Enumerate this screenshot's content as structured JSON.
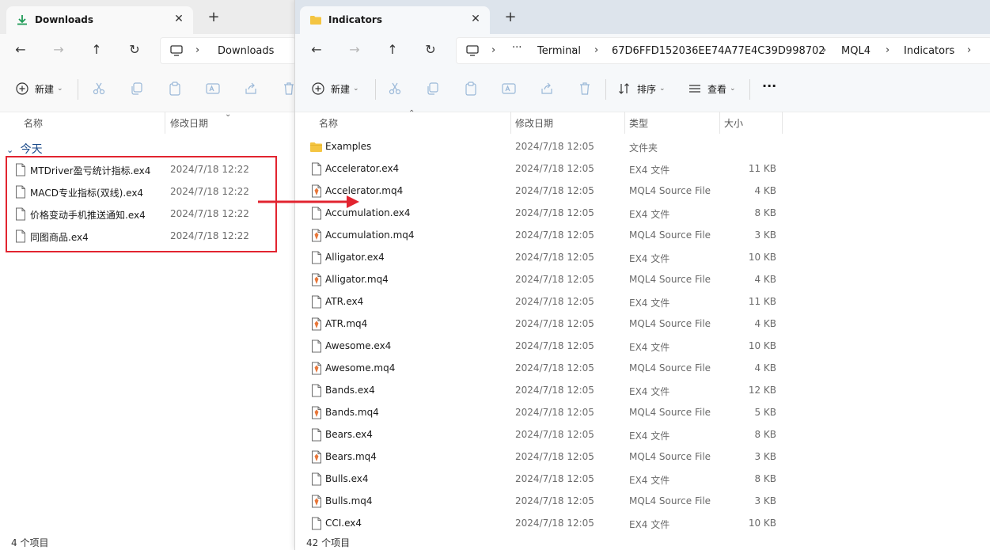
{
  "left": {
    "tab_title": "Downloads",
    "tab_close": "✕",
    "new_tab": "+",
    "breadcrumb": "Downloads",
    "new_label": "新建",
    "columns": {
      "name": "名称",
      "date": "修改日期"
    },
    "group_label": "今天",
    "files": [
      {
        "name": "MTDriver盈亏统计指标.ex4",
        "date": "2024/7/18 12:22"
      },
      {
        "name": "MACD专业指标(双线).ex4",
        "date": "2024/7/18 12:22"
      },
      {
        "name": "价格变动手机推送通知.ex4",
        "date": "2024/7/18 12:22"
      },
      {
        "name": "同图商品.ex4",
        "date": "2024/7/18 12:22"
      }
    ],
    "status": "4 个项目"
  },
  "right": {
    "tab_title": "Indicators",
    "tab_close": "✕",
    "new_tab": "+",
    "breadcrumbs": [
      "Terminal",
      "67D6FFD152036EE74A77E4C39D998702",
      "MQL4",
      "Indicators"
    ],
    "more": "···",
    "toolbar": {
      "new_label": "新建",
      "sort_label": "排序",
      "view_label": "查看",
      "more": "···"
    },
    "columns": {
      "name": "名称",
      "date": "修改日期",
      "type": "类型",
      "size": "大小"
    },
    "files": [
      {
        "name": "Examples",
        "date": "2024/7/18 12:05",
        "type": "文件夹",
        "size": "",
        "kind": "folder"
      },
      {
        "name": "Accelerator.ex4",
        "date": "2024/7/18 12:05",
        "type": "EX4 文件",
        "size": "11 KB",
        "kind": "ex4"
      },
      {
        "name": "Accelerator.mq4",
        "date": "2024/7/18 12:05",
        "type": "MQL4 Source File",
        "size": "4 KB",
        "kind": "mq4"
      },
      {
        "name": "Accumulation.ex4",
        "date": "2024/7/18 12:05",
        "type": "EX4 文件",
        "size": "8 KB",
        "kind": "ex4"
      },
      {
        "name": "Accumulation.mq4",
        "date": "2024/7/18 12:05",
        "type": "MQL4 Source File",
        "size": "3 KB",
        "kind": "mq4"
      },
      {
        "name": "Alligator.ex4",
        "date": "2024/7/18 12:05",
        "type": "EX4 文件",
        "size": "10 KB",
        "kind": "ex4"
      },
      {
        "name": "Alligator.mq4",
        "date": "2024/7/18 12:05",
        "type": "MQL4 Source File",
        "size": "4 KB",
        "kind": "mq4"
      },
      {
        "name": "ATR.ex4",
        "date": "2024/7/18 12:05",
        "type": "EX4 文件",
        "size": "11 KB",
        "kind": "ex4"
      },
      {
        "name": "ATR.mq4",
        "date": "2024/7/18 12:05",
        "type": "MQL4 Source File",
        "size": "4 KB",
        "kind": "mq4"
      },
      {
        "name": "Awesome.ex4",
        "date": "2024/7/18 12:05",
        "type": "EX4 文件",
        "size": "10 KB",
        "kind": "ex4"
      },
      {
        "name": "Awesome.mq4",
        "date": "2024/7/18 12:05",
        "type": "MQL4 Source File",
        "size": "4 KB",
        "kind": "mq4"
      },
      {
        "name": "Bands.ex4",
        "date": "2024/7/18 12:05",
        "type": "EX4 文件",
        "size": "12 KB",
        "kind": "ex4"
      },
      {
        "name": "Bands.mq4",
        "date": "2024/7/18 12:05",
        "type": "MQL4 Source File",
        "size": "5 KB",
        "kind": "mq4"
      },
      {
        "name": "Bears.ex4",
        "date": "2024/7/18 12:05",
        "type": "EX4 文件",
        "size": "8 KB",
        "kind": "ex4"
      },
      {
        "name": "Bears.mq4",
        "date": "2024/7/18 12:05",
        "type": "MQL4 Source File",
        "size": "3 KB",
        "kind": "mq4"
      },
      {
        "name": "Bulls.ex4",
        "date": "2024/7/18 12:05",
        "type": "EX4 文件",
        "size": "8 KB",
        "kind": "ex4"
      },
      {
        "name": "Bulls.mq4",
        "date": "2024/7/18 12:05",
        "type": "MQL4 Source File",
        "size": "3 KB",
        "kind": "mq4"
      },
      {
        "name": "CCI.ex4",
        "date": "2024/7/18 12:05",
        "type": "EX4 文件",
        "size": "10 KB",
        "kind": "ex4"
      }
    ],
    "status": "42 个项目"
  },
  "colors": {
    "accent": "#0067c0",
    "highlight_box": "#e22430",
    "arrow": "#e22430",
    "folder": "#f4c542",
    "mq4_icon": "#e8773a"
  }
}
